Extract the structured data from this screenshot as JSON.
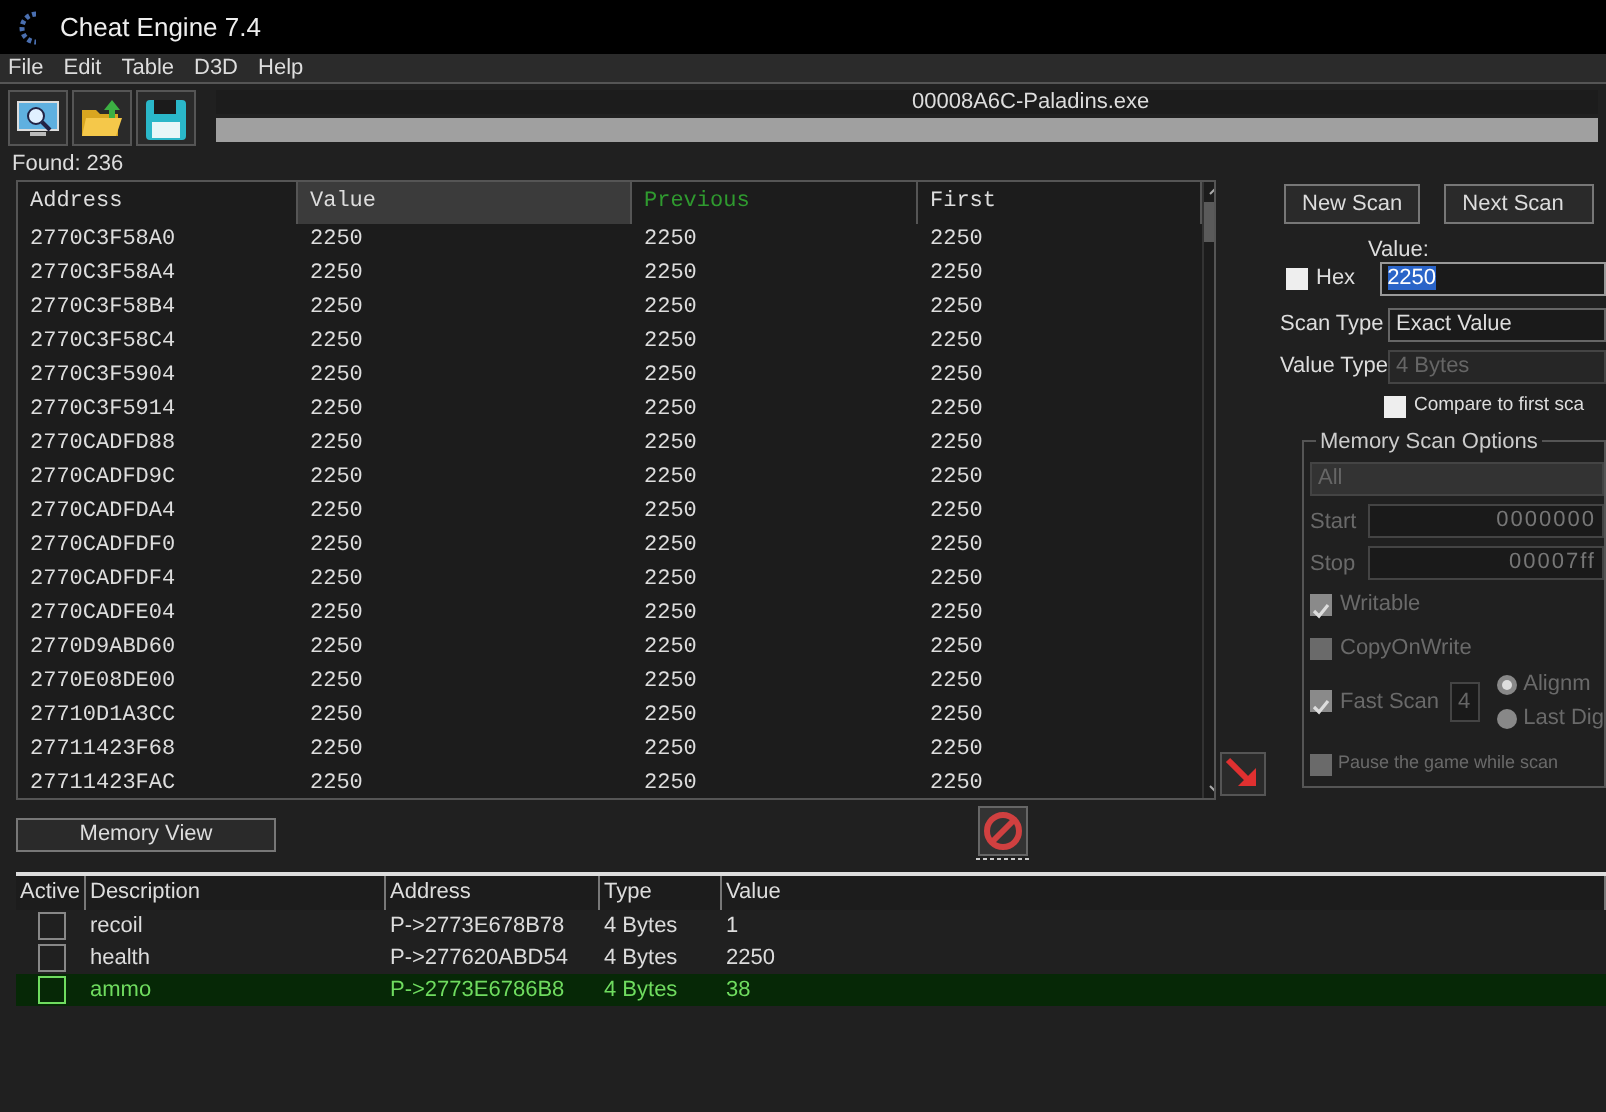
{
  "window": {
    "title": "Cheat Engine 7.4"
  },
  "menu": [
    {
      "label": "File"
    },
    {
      "label": "Edit"
    },
    {
      "label": "Table"
    },
    {
      "label": "D3D"
    },
    {
      "label": "Help"
    }
  ],
  "process_name": "00008A6C-Paladins.exe",
  "scan_progress": {
    "level": 0
  },
  "found": "Found: 236",
  "results": {
    "columns": [
      {
        "label": "Address",
        "highlighted": false
      },
      {
        "label": "Value",
        "highlighted": true
      },
      {
        "label": "Previous",
        "highlighted": false,
        "color": "#2f9a2f"
      },
      {
        "label": "First",
        "highlighted": false
      }
    ],
    "rows": [
      {
        "address": "2770C3F58A0",
        "value": "2250",
        "previous": "2250",
        "first": "2250"
      },
      {
        "address": "2770C3F58A4",
        "value": "2250",
        "previous": "2250",
        "first": "2250"
      },
      {
        "address": "2770C3F58B4",
        "value": "2250",
        "previous": "2250",
        "first": "2250"
      },
      {
        "address": "2770C3F58C4",
        "value": "2250",
        "previous": "2250",
        "first": "2250"
      },
      {
        "address": "2770C3F5904",
        "value": "2250",
        "previous": "2250",
        "first": "2250"
      },
      {
        "address": "2770C3F5914",
        "value": "2250",
        "previous": "2250",
        "first": "2250"
      },
      {
        "address": "2770CADFD88",
        "value": "2250",
        "previous": "2250",
        "first": "2250"
      },
      {
        "address": "2770CADFD9C",
        "value": "2250",
        "previous": "2250",
        "first": "2250"
      },
      {
        "address": "2770CADFDA4",
        "value": "2250",
        "previous": "2250",
        "first": "2250"
      },
      {
        "address": "2770CADFDF0",
        "value": "2250",
        "previous": "2250",
        "first": "2250"
      },
      {
        "address": "2770CADFDF4",
        "value": "2250",
        "previous": "2250",
        "first": "2250"
      },
      {
        "address": "2770CADFE04",
        "value": "2250",
        "previous": "2250",
        "first": "2250"
      },
      {
        "address": "2770D9ABD60",
        "value": "2250",
        "previous": "2250",
        "first": "2250"
      },
      {
        "address": "2770E08DE00",
        "value": "2250",
        "previous": "2250",
        "first": "2250"
      },
      {
        "address": "27710D1A3CC",
        "value": "2250",
        "previous": "2250",
        "first": "2250"
      },
      {
        "address": "27711423F68",
        "value": "2250",
        "previous": "2250",
        "first": "2250"
      },
      {
        "address": "27711423FAC",
        "value": "2250",
        "previous": "2250",
        "first": "2250"
      }
    ]
  },
  "scan": {
    "new_scan": "New Scan",
    "next_scan": "Next Scan",
    "value_label": "Value:",
    "hex": {
      "label": "Hex",
      "checked": false
    },
    "value": "2250",
    "scan_type_label": "Scan Type",
    "scan_type": "Exact Value",
    "value_type_label": "Value Type",
    "value_type": "4 Bytes",
    "compare": {
      "label": "Compare to first sca",
      "checked": false
    },
    "memory_scan_options": {
      "title": "Memory Scan Options",
      "region": "All",
      "start_label": "Start",
      "start": "0000000",
      "stop_label": "Stop",
      "stop": "00007ff",
      "writable": {
        "label": "Writable",
        "checked": true
      },
      "copy_on_write": {
        "label": "CopyOnWrite",
        "checked": false
      },
      "fast_scan": {
        "label": "Fast Scan",
        "checked": true,
        "value": "4"
      },
      "alignment": [
        {
          "label": "Alignm",
          "selected": true
        },
        {
          "label": "Last Dig",
          "selected": false
        }
      ],
      "pause": {
        "label": "Pause the game while scan",
        "checked": false
      }
    }
  },
  "memory_view": "Memory View",
  "cheat_table": {
    "columns": [
      {
        "label": "Active"
      },
      {
        "label": "Description"
      },
      {
        "label": "Address"
      },
      {
        "label": "Type"
      },
      {
        "label": "Value"
      }
    ],
    "entries": [
      {
        "active": false,
        "description": "recoil",
        "address": "P->2773E678B78",
        "type": "4 Bytes",
        "value": "1",
        "selected": false
      },
      {
        "active": false,
        "description": "health",
        "address": "P->277620ABD54",
        "type": "4 Bytes",
        "value": "2250",
        "selected": false
      },
      {
        "active": false,
        "description": "ammo",
        "address": "P->2773E6786B8",
        "type": "4 Bytes",
        "value": "38",
        "selected": true
      }
    ]
  }
}
